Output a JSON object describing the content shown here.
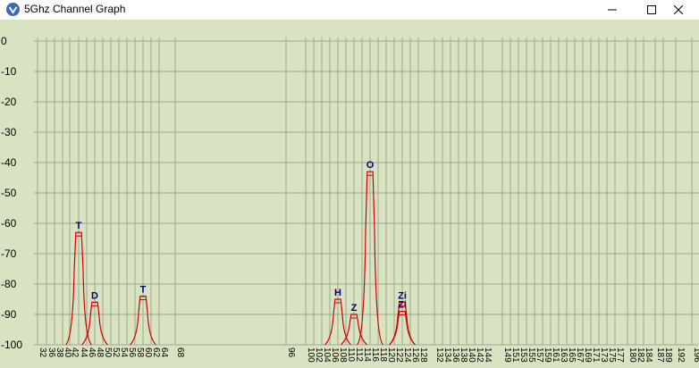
{
  "window": {
    "title": "5Ghz Channel Graph",
    "icons": {
      "app": "app-icon",
      "minimize": "minimize-icon",
      "maximize": "maximize-icon",
      "close": "close-icon"
    }
  },
  "chart_data": {
    "type": "area",
    "title": "",
    "xlabel": "",
    "ylabel": "",
    "ylim": [
      -100,
      0
    ],
    "y_ticks": [
      "0",
      "-10",
      "-20",
      "-30",
      "-40",
      "-50",
      "-60",
      "-70",
      "-80",
      "-90",
      "-100"
    ],
    "x_channel_labels": [
      "32",
      "36",
      "38",
      "40",
      "42",
      "44",
      "46",
      "48",
      "50",
      "52",
      "54",
      "56",
      "58",
      "60",
      "62",
      "64",
      "68",
      "96",
      "100",
      "102",
      "104",
      "106",
      "108",
      "110",
      "112",
      "114",
      "116",
      "118",
      "120",
      "122",
      "124",
      "126",
      "128",
      "132",
      "134",
      "136",
      "138",
      "140",
      "142",
      "144",
      "149",
      "151",
      "153",
      "155",
      "157",
      "159",
      "161",
      "163",
      "165",
      "167",
      "169",
      "171",
      "173",
      "175",
      "177",
      "180",
      "182",
      "184",
      "187",
      "189",
      "192",
      "196"
    ],
    "grid": true,
    "series_color": "#cc0000",
    "series": [
      {
        "label": "T",
        "center_channel": 44,
        "width": 20,
        "dbm": -63
      },
      {
        "label": "D",
        "center_channel": 48,
        "width": 20,
        "dbm": -86
      },
      {
        "label": "T",
        "center_channel": 60,
        "width": 20,
        "dbm": -84
      },
      {
        "label": "H",
        "center_channel": 108,
        "width": 20,
        "dbm": -85
      },
      {
        "label": "Z",
        "center_channel": 112,
        "width": 20,
        "dbm": -90
      },
      {
        "label": "O",
        "center_channel": 116,
        "width": 20,
        "dbm": -43
      },
      {
        "label": "Zi",
        "center_channel": 124,
        "width": 20,
        "dbm": -86
      },
      {
        "label": "Zi",
        "center_channel": 124,
        "width": 20,
        "dbm": -89
      }
    ]
  }
}
